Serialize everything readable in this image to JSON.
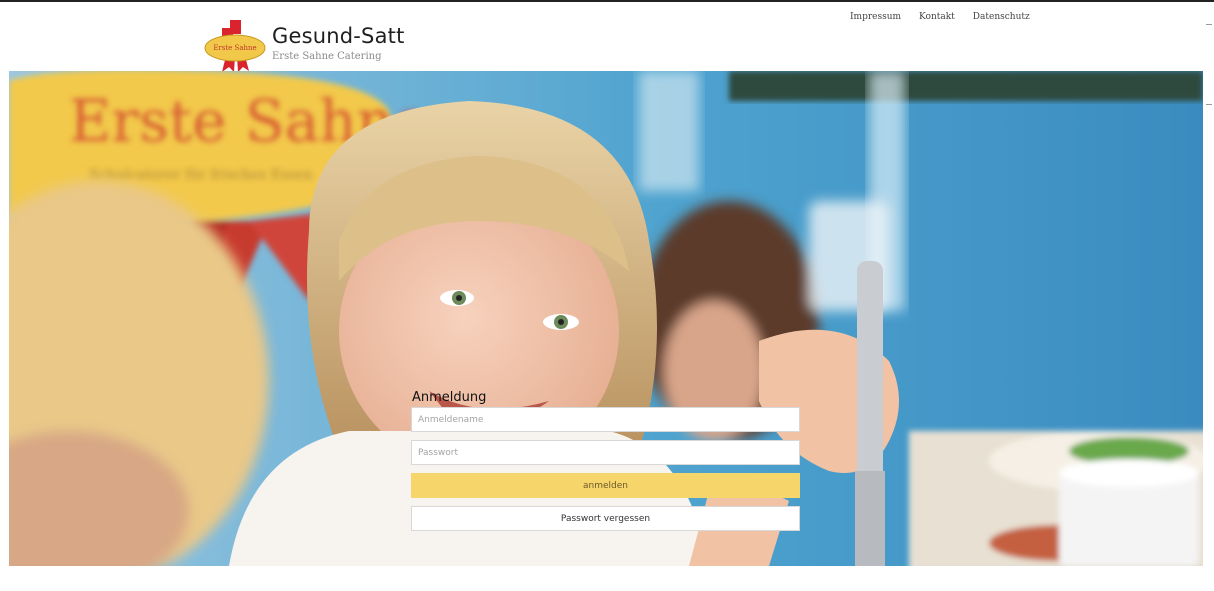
{
  "header": {
    "logo_text": "Erste Sahne",
    "site_title": "Gesund-Satt",
    "site_subtitle": "Erste Sahne Catering",
    "nav": [
      {
        "label": "Impressum"
      },
      {
        "label": "Kontakt"
      },
      {
        "label": "Datenschutz"
      }
    ]
  },
  "hero": {
    "banner_text": "Erste Sahne",
    "banner_subtext": "Schulcaterer für frisches Essen"
  },
  "login": {
    "title": "Anmeldung",
    "username_placeholder": "Anmeldename",
    "password_placeholder": "Passwort",
    "submit_label": "anmelden",
    "forgot_label": "Passwort vergessen"
  },
  "colors": {
    "primary_button": "#f6d66a",
    "banner_yellow": "#f2c94c",
    "banner_text_red": "#cf3b2c"
  }
}
